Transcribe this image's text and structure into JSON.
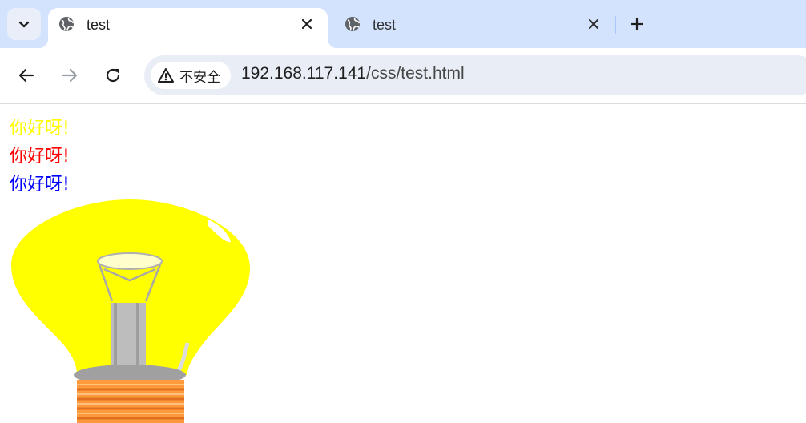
{
  "browser": {
    "tabs": [
      {
        "title": "test",
        "active": true
      },
      {
        "title": "test",
        "active": false
      }
    ],
    "address_bar": {
      "security_label": "不安全",
      "url_host": "192.168.117.141",
      "url_path": "/css/test.html"
    }
  },
  "page": {
    "greetings": [
      {
        "text": "你好呀!",
        "color": "#ffff00"
      },
      {
        "text": "你好呀!",
        "color": "#ff0000"
      },
      {
        "text": "你好呀!",
        "color": "#0000ff"
      }
    ],
    "image": {
      "subject": "light-bulb",
      "colors": {
        "glass": "#ffff00",
        "base": "#ff9a3c",
        "filament": "#c0c0c0"
      }
    }
  }
}
